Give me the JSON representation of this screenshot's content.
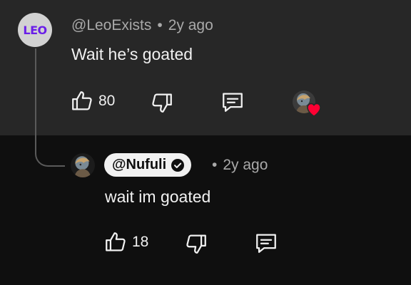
{
  "comment": {
    "avatar_text": "LEO",
    "author": "@LeoExists",
    "separator": "•",
    "time": "2y ago",
    "text": "Wait he’s goated",
    "like_count": "80",
    "hearted": true
  },
  "reply": {
    "author": "@Nufuli",
    "verified": true,
    "separator": "•",
    "time": "2y ago",
    "text": "wait im goated",
    "like_count": "18"
  },
  "colors": {
    "top_bg": "#272727",
    "page_bg": "#0f0f0f",
    "heart": "#ff0033",
    "leo_text": "#6a1ee8"
  }
}
